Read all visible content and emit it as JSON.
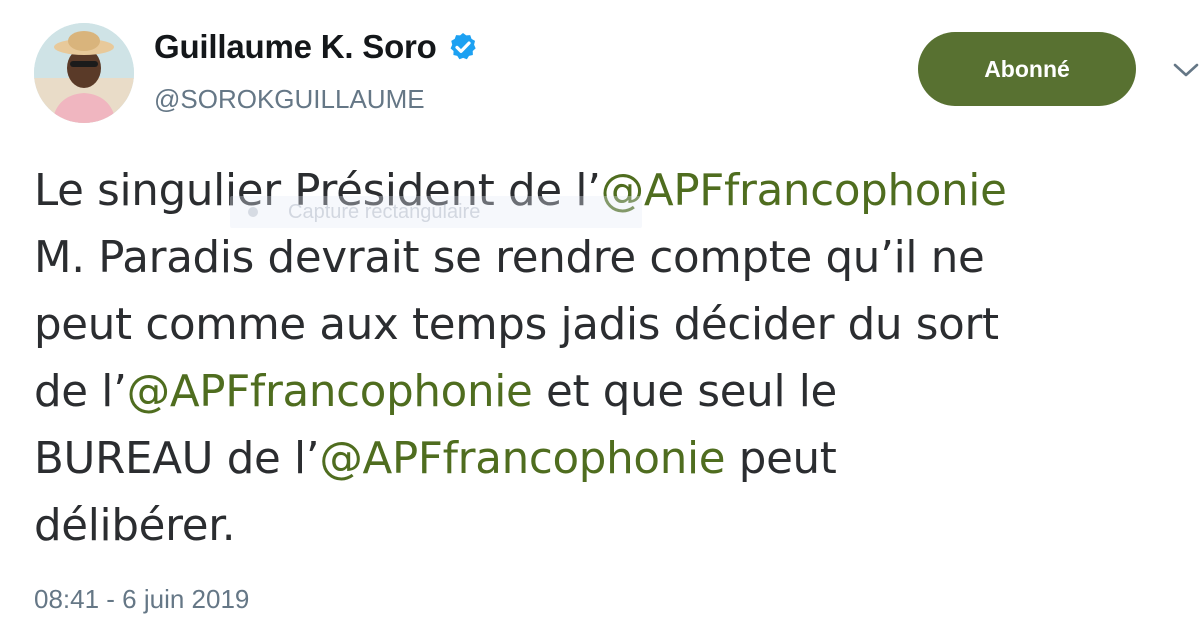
{
  "user": {
    "display_name": "Guillaume K. Soro",
    "handle": "@SOROKGUILLAUME",
    "verified": true
  },
  "follow_button": {
    "label": "Abonné"
  },
  "tweet": {
    "lines": [
      [
        {
          "text": "Le singulier Président de l’"
        },
        {
          "text": "@APFfrancophonie",
          "mention": true
        }
      ],
      [
        {
          "text": "M. Paradis devrait se rendre compte qu’il ne"
        }
      ],
      [
        {
          "text": "peut comme aux temps jadis décider du sort"
        }
      ],
      [
        {
          "text": "de l’"
        },
        {
          "text": "@APFfrancophonie",
          "mention": true
        },
        {
          "text": " et que seul le"
        }
      ],
      [
        {
          "text": "BUREAU de l’"
        },
        {
          "text": "@APFfrancophonie",
          "mention": true
        },
        {
          "text": " peut"
        }
      ],
      [
        {
          "text": "délibérer."
        }
      ]
    ],
    "timestamp": "08:41 - 6 juin 2019"
  },
  "overlay": {
    "label": "Capture rectangulaire"
  },
  "colors": {
    "accent_green": "#587131",
    "mention_green": "#4f6d1f",
    "verified_blue": "#1da1f2",
    "secondary_text": "#657786"
  },
  "icons": [
    "verified-badge-icon",
    "chevron-down-icon"
  ]
}
